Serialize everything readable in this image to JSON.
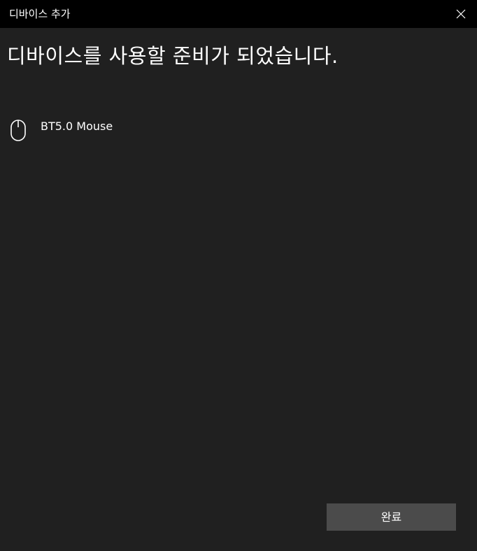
{
  "window": {
    "title": "디바이스 추가",
    "close_icon": "close-icon"
  },
  "main": {
    "heading": "디바이스를 사용할 준비가 되었습니다.",
    "devices": [
      {
        "name": "BT5.0 Mouse",
        "icon": "mouse-icon"
      }
    ]
  },
  "footer": {
    "done_label": "완료"
  },
  "colors": {
    "titlebar_bg": "#000000",
    "window_bg": "#202020",
    "button_bg": "#4b4b4b",
    "text": "#ffffff"
  }
}
